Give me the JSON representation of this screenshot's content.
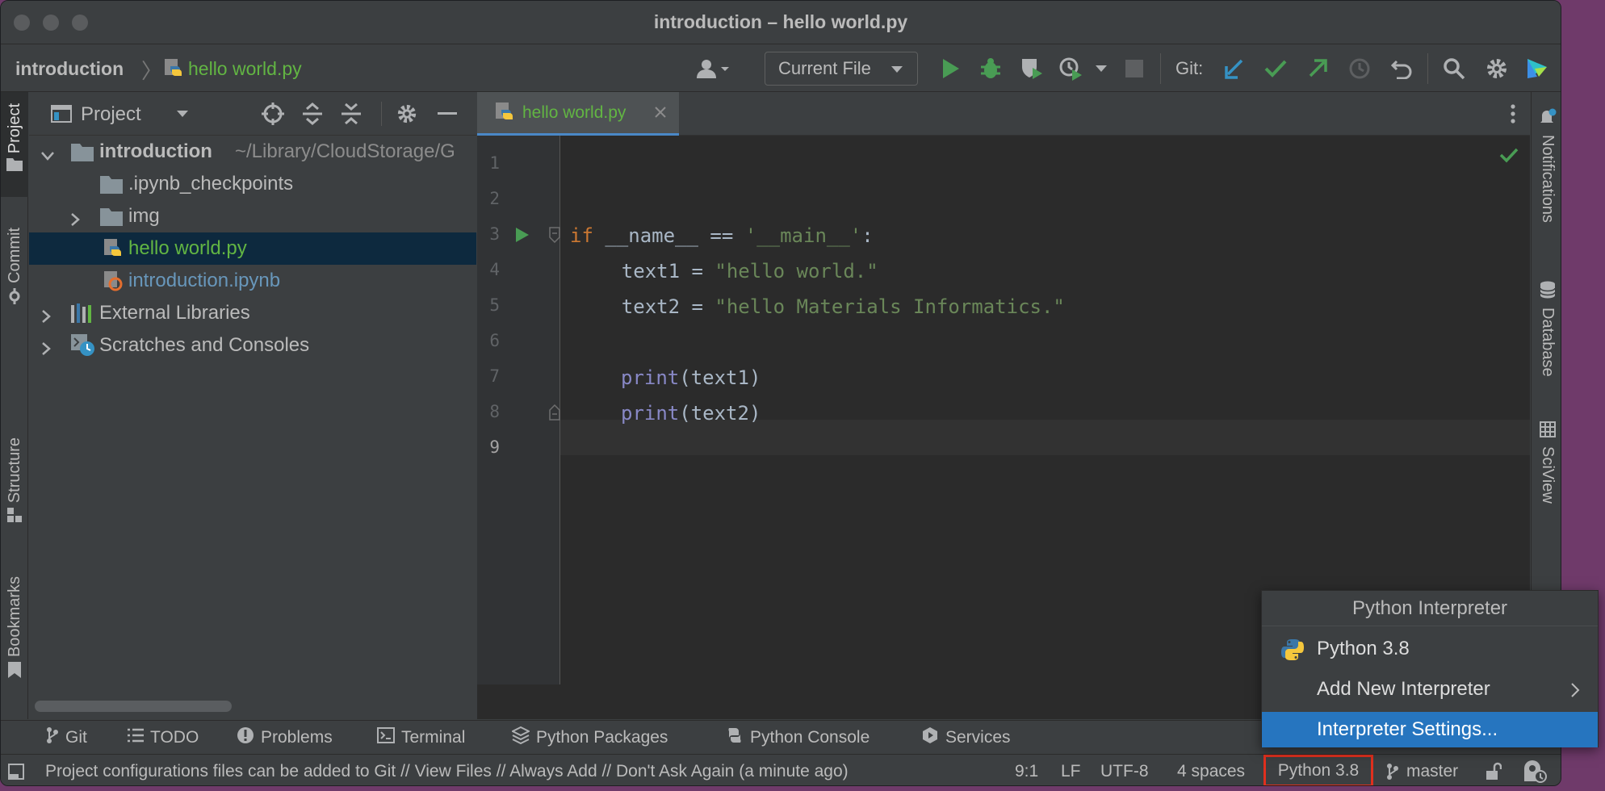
{
  "window": {
    "title": "introduction – hello world.py"
  },
  "navbar": {
    "breadcrumb_project": "introduction",
    "breadcrumb_file": "hello world.py",
    "run_config": "Current File",
    "git_label": "Git:"
  },
  "left_tabs": {
    "project": "Project",
    "commit": "Commit",
    "structure": "Structure",
    "bookmarks": "Bookmarks"
  },
  "right_tabs": {
    "notifications": "Notifications",
    "database": "Database",
    "sciview": "SciView"
  },
  "project_panel": {
    "title": "Project",
    "tree": [
      {
        "label": "introduction",
        "suffix": "~/Library/CloudStorage/G"
      },
      {
        "label": ".ipynb_checkpoints"
      },
      {
        "label": "img"
      },
      {
        "label": "hello world.py"
      },
      {
        "label": "introduction.ipynb"
      },
      {
        "label": "External Libraries"
      },
      {
        "label": "Scratches and Consoles"
      }
    ]
  },
  "editor": {
    "tab_label": "hello world.py",
    "line_numbers": [
      "1",
      "2",
      "3",
      "4",
      "5",
      "6",
      "7",
      "8",
      "9"
    ],
    "code": {
      "l3_kw": "if",
      "l3_rest": " __name__ == ",
      "l3_str": "'__main__'",
      "l3_colon": ":",
      "l4_var": "    text1 = ",
      "l4_str": "\"hello world.\"",
      "l5_var": "    text2 = ",
      "l5_str": "\"hello Materials Informatics.\"",
      "l7_fn": "print",
      "l7_args": "(text1)",
      "l8_fn": "print",
      "l8_args": "(text2)"
    }
  },
  "tool_windows": [
    "Git",
    "TODO",
    "Problems",
    "Terminal",
    "Python Packages",
    "Python Console",
    "Services"
  ],
  "status": {
    "message": "Project configurations files can be added to Git // View Files // Always Add // Don't Ask Again (a minute ago)",
    "position": "9:1",
    "line_sep": "LF",
    "encoding": "UTF-8",
    "indent": "4 spaces",
    "interpreter": "Python 3.8",
    "branch": "master"
  },
  "popup": {
    "title": "Python Interpreter",
    "items": [
      "Python 3.8",
      "Add New Interpreter",
      "Interpreter Settings..."
    ]
  },
  "colors": {
    "accent": "#2675bf",
    "highlight_box": "#e0301e",
    "green": "#499c54",
    "file_green": "#62b543",
    "ipynb_blue": "#6897bb"
  }
}
